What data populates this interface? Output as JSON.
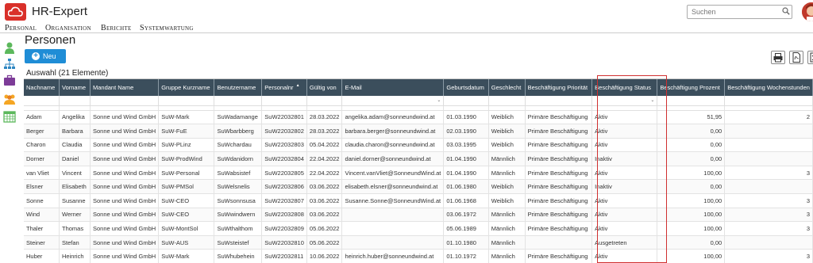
{
  "app": {
    "title": "HR-Expert"
  },
  "search": {
    "placeholder": "Suchen"
  },
  "menu": [
    "Personal",
    "Organisation",
    "Berichte",
    "Systemwartung"
  ],
  "page": {
    "title": "Personen",
    "new_label": "Neu",
    "selection": "Auswahl (21 Elemente)"
  },
  "columns": [
    {
      "label": "Nachname",
      "w": 46
    },
    {
      "label": "Vorname",
      "w": 40
    },
    {
      "label": "Mandant Name",
      "w": 85
    },
    {
      "label": "Gruppe Kurzname",
      "w": 72
    },
    {
      "label": "Benutzername",
      "w": 61
    },
    {
      "label": "Personalnr",
      "w": 55,
      "sorted": true
    },
    {
      "label": "Gültig von",
      "w": 44
    },
    {
      "label": "E-Mail",
      "w": 128
    },
    {
      "label": "Geburtsdatum",
      "w": 58
    },
    {
      "label": "Geschlecht",
      "w": 47
    },
    {
      "label": "Beschäftigung Priorität",
      "w": 86
    },
    {
      "label": "Beschäftigung Status",
      "w": 86
    },
    {
      "label": "Beschäftigung Prozent",
      "w": 87
    },
    {
      "label": "Beschäftigung Wochenstunden",
      "w": 110
    }
  ],
  "filter_dropdown_cols": [
    7,
    11
  ],
  "rows": [
    [
      "Adam",
      "Angelika",
      "Sonne und Wind GmbH",
      "SuW-Mark",
      "SuWadamange",
      "SuW22032801",
      "28.03.2022",
      "angelika.adam@sonneundwind.at",
      "01.03.1990",
      "Weiblich",
      "Primäre Beschäftigung",
      "Aktiv",
      "51,95",
      "2"
    ],
    [
      "Berger",
      "Barbara",
      "Sonne und Wind GmbH",
      "SuW-FuE",
      "SuWbarbberg",
      "SuW22032802",
      "28.03.2022",
      "barbara.berger@sonneundwind.at",
      "02.03.1990",
      "Weiblich",
      "Primäre Beschäftigung",
      "Aktiv",
      "0,00",
      ""
    ],
    [
      "Charon",
      "Claudia",
      "Sonne und Wind GmbH",
      "SuW-PLinz",
      "SuWchardau",
      "SuW22032803",
      "05.04.2022",
      "claudia.charon@sonneundwind.at",
      "03.03.1995",
      "Weiblich",
      "Primäre Beschäftigung",
      "Aktiv",
      "0,00",
      ""
    ],
    [
      "Dorner",
      "Daniel",
      "Sonne und Wind GmbH",
      "SuW-ProdWind",
      "SuWdanidorn",
      "SuW22032804",
      "22.04.2022",
      "daniel.dorner@sonneundwind.at",
      "01.04.1990",
      "Männlich",
      "Primäre Beschäftigung",
      "Inaktiv",
      "0,00",
      ""
    ],
    [
      "van Vliet",
      "Vincent",
      "Sonne und Wind GmbH",
      "SuW-Personal",
      "SuWabsistef",
      "SuW22032805",
      "22.04.2022",
      "Vincent.vanVliet@SonneundWind.at",
      "01.04.1990",
      "Männlich",
      "Primäre Beschäftigung",
      "Aktiv",
      "100,00",
      "3"
    ],
    [
      "Elsner",
      "Elisabeth",
      "Sonne und Wind GmbH",
      "SuW-PMSol",
      "SuWelsnelis",
      "SuW22032806",
      "03.06.2022",
      "elisabeth.elsner@sonneundwind.at",
      "01.06.1980",
      "Weiblich",
      "Primäre Beschäftigung",
      "Inaktiv",
      "0,00",
      ""
    ],
    [
      "Sonne",
      "Susanne",
      "Sonne und Wind GmbH",
      "SuW-CEO",
      "SuWsonnsusa",
      "SuW22032807",
      "03.06.2022",
      "Susanne.Sonne@SonneundWind.at",
      "01.06.1968",
      "Weiblich",
      "Primäre Beschäftigung",
      "Aktiv",
      "100,00",
      "3"
    ],
    [
      "Wind",
      "Werner",
      "Sonne und Wind GmbH",
      "SuW-CEO",
      "SuWwindwern",
      "SuW22032808",
      "03.06.2022",
      "",
      "03.06.1972",
      "Männlich",
      "Primäre Beschäftigung",
      "Aktiv",
      "100,00",
      "3"
    ],
    [
      "Thaler",
      "Thomas",
      "Sonne und Wind GmbH",
      "SuW-MontSol",
      "SuWthalthom",
      "SuW22032809",
      "05.06.2022",
      "",
      "05.06.1989",
      "Männlich",
      "Primäre Beschäftigung",
      "Aktiv",
      "100,00",
      "3"
    ],
    [
      "Steiner",
      "Stefan",
      "Sonne und Wind GmbH",
      "SuW-AUS",
      "SuWsteistef",
      "SuW22032810",
      "05.06.2022",
      "",
      "01.10.1980",
      "Männlich",
      "",
      "Ausgetreten",
      "0,00",
      ""
    ],
    [
      "Huber",
      "Heinrich",
      "Sonne und Wind GmbH",
      "SuW-Mark",
      "SuWhubehein",
      "SuW22032811",
      "10.06.2022",
      "heinrich.huber@sonneundwind.at",
      "01.10.1972",
      "Männlich",
      "Primäre Beschäftigung",
      "Aktiv",
      "100,00",
      "3"
    ]
  ],
  "colors": {
    "accent": "#1f8dd6",
    "brand": "#d9302a",
    "header": "#3b4e5c",
    "highlight": "#d03030"
  }
}
